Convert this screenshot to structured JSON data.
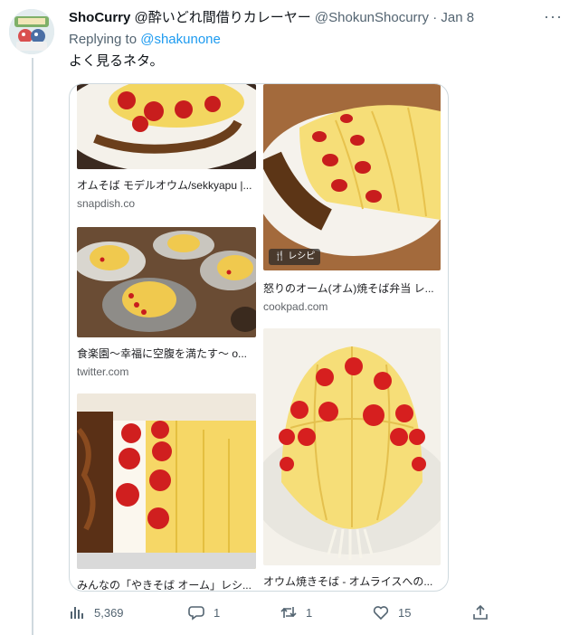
{
  "tweet": {
    "display_name": "ShoCurry",
    "handle_bio": "@酔いどれ間借りカレーヤー",
    "username": "@ShokunShocurry",
    "separator": " · ",
    "date": "Jan 8",
    "more": "···",
    "replying_prefix": "Replying to ",
    "replying_to": "@shakunone",
    "text": "よく見るネタ。"
  },
  "media": {
    "cards": [
      {
        "caption": "オムそば モデルオウム/sekkyapu |...",
        "source": "snapdish.co"
      },
      {
        "caption": "怒りのオーム(オム)焼そば弁当 レ...",
        "source": "cookpad.com",
        "badge": "レシピ"
      },
      {
        "caption": "食楽園〜幸福に空腹を満たす〜 o...",
        "source": "twitter.com"
      },
      {
        "caption": "みんなの「やきそば オーム」レシ...",
        "source": ""
      },
      {
        "caption": "オウム焼きそば - オムライスへの...",
        "source": ""
      }
    ]
  },
  "actions": {
    "views": "5,369",
    "replies": "1",
    "retweets": "1",
    "likes": "15"
  },
  "colors": {
    "link": "#1d9bf0",
    "secondary_text": "#536471",
    "divider": "#cfd9de"
  }
}
